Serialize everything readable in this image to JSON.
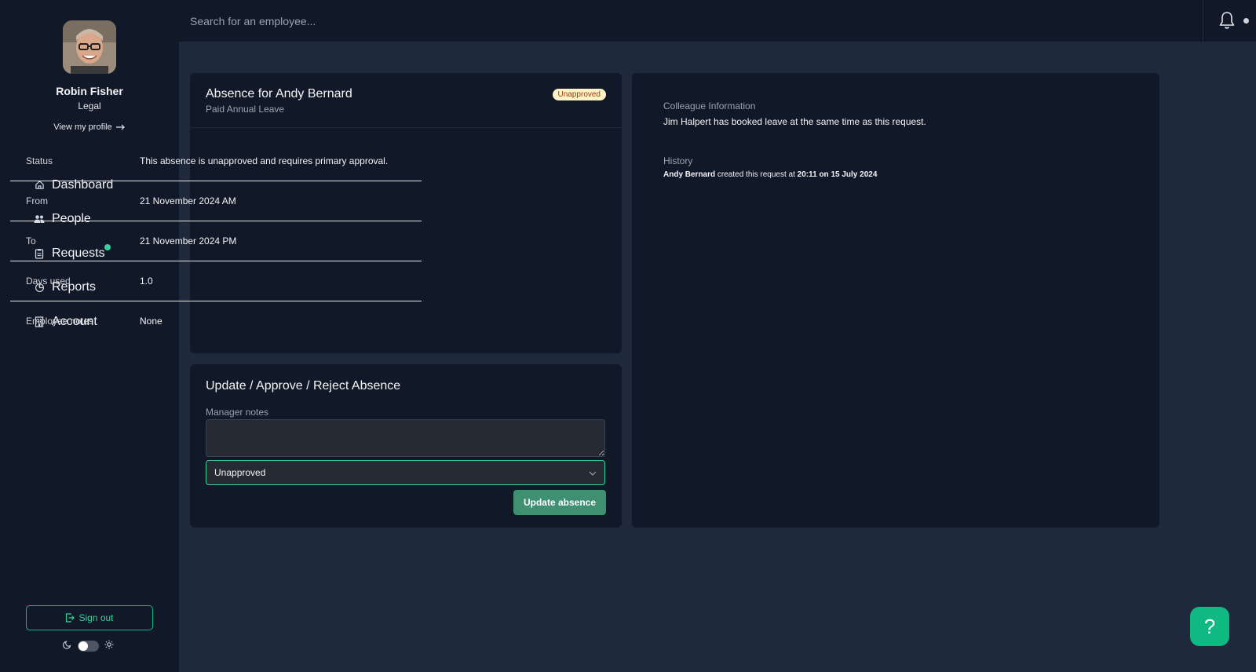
{
  "user": {
    "name": "Robin Fisher",
    "department": "Legal",
    "profile_link": "View my profile"
  },
  "nav": {
    "items": [
      {
        "label": "Dashboard",
        "icon": "home-icon"
      },
      {
        "label": "People",
        "icon": "users-icon"
      },
      {
        "label": "Requests",
        "icon": "clipboard-icon",
        "has_notification": true
      },
      {
        "label": "Reports",
        "icon": "pie-chart-icon"
      },
      {
        "label": "Account",
        "icon": "building-icon"
      }
    ]
  },
  "sidebar": {
    "signout_label": "Sign out"
  },
  "search": {
    "placeholder": "Search for an employee..."
  },
  "absence": {
    "title": "Absence for Andy Bernard",
    "subtitle": "Paid Annual Leave",
    "badge": "Unapproved",
    "details": [
      {
        "label": "Status",
        "value": "This absence is unapproved and requires primary approval."
      },
      {
        "label": "From",
        "value": "21 November 2024 AM"
      },
      {
        "label": "To",
        "value": "21 November 2024 PM"
      },
      {
        "label": "Days used",
        "value": "1.0"
      },
      {
        "label": "Employee notes",
        "value": "None"
      }
    ]
  },
  "update_form": {
    "title": "Update / Approve / Reject Absence",
    "notes_label": "Manager notes",
    "notes_value": "",
    "status_selected": "Unapproved",
    "submit_label": "Update absence"
  },
  "info": {
    "colleague_heading": "Colleague Information",
    "colleague_text": "Jim Halpert has booked leave at the same time as this request.",
    "history_heading": "History",
    "history_actor": "Andy Bernard",
    "history_action": " created this request at ",
    "history_time": "20:11 on 15 July 2024"
  },
  "help": {
    "label": "?"
  },
  "colors": {
    "sidebar_bg": "#111827",
    "page_bg": "#1e293b",
    "accent": "#10b981",
    "badge_bg": "#fef3c7"
  }
}
